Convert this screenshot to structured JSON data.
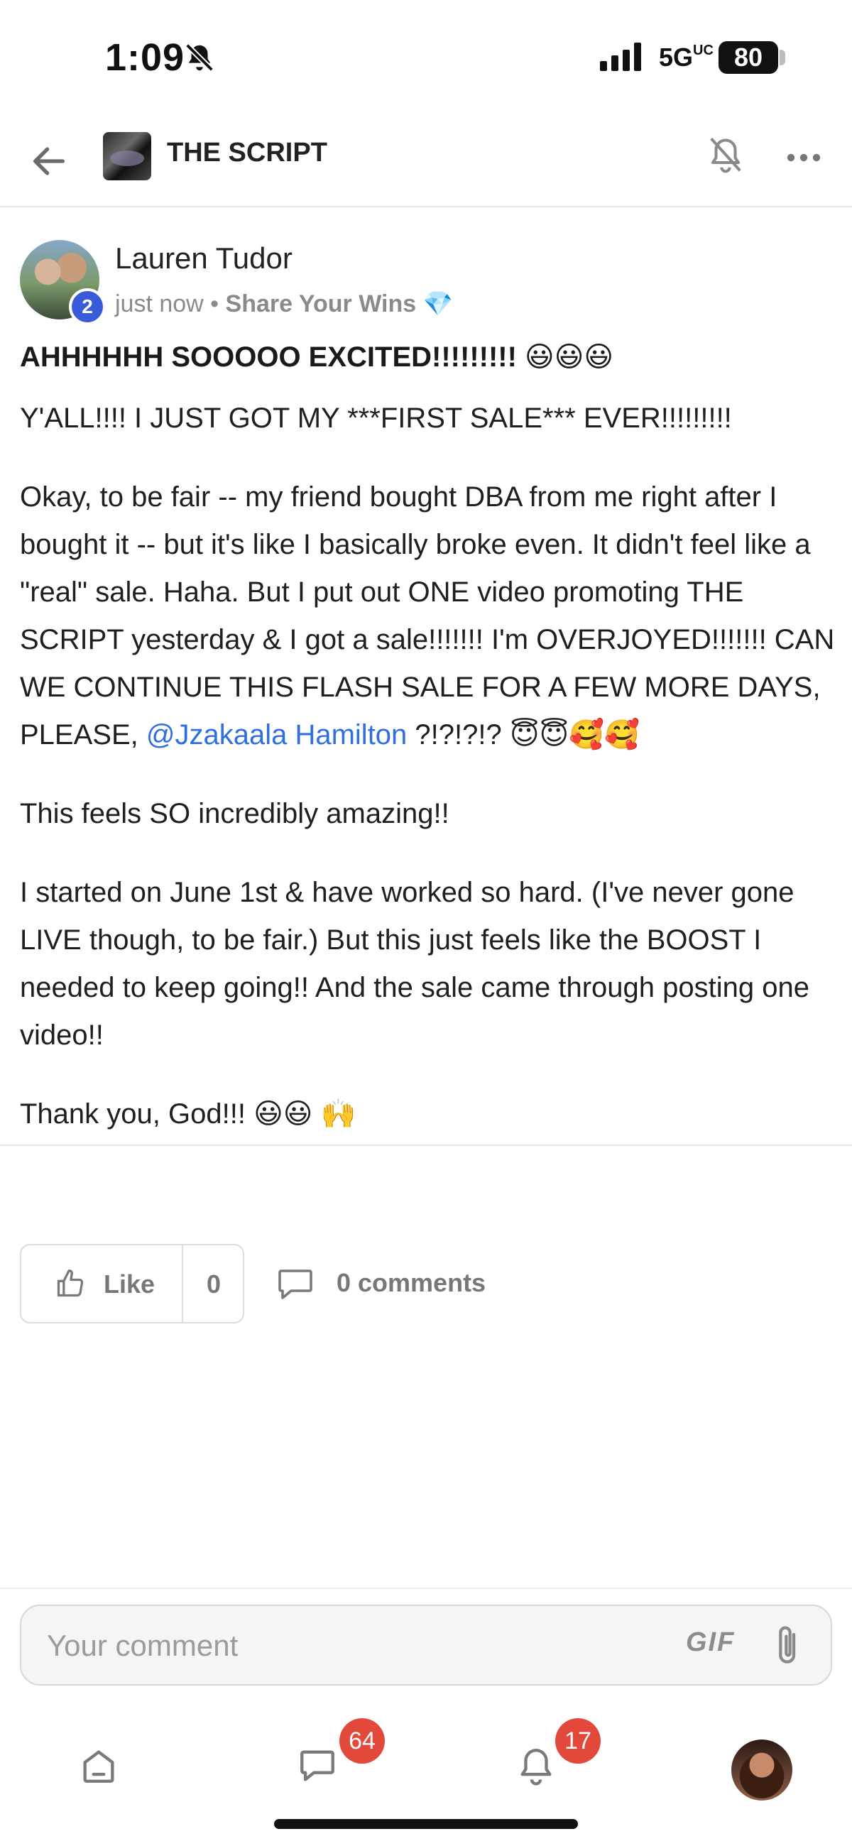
{
  "status_bar": {
    "time": "1:09",
    "network": "5G",
    "network_suffix": "UC",
    "battery": "80"
  },
  "header": {
    "title": "THE SCRIPT"
  },
  "post": {
    "author": "Lauren Tudor",
    "level": "2",
    "timestamp": "just now",
    "separator": " • ",
    "category": "Share Your Wins",
    "category_emoji": "💎",
    "title": "AHHHHHH SOOOOO EXCITED!!!!!!!!! 😃😃😃",
    "paragraphs": {
      "p1": "Y'ALL!!!! I JUST GOT MY ***FIRST SALE*** EVER!!!!!!!!!",
      "p2_start": "Okay, to be fair -- my friend bought DBA from me right after I bought it -- but it's like I basically broke even. It didn't feel like a \"real\" sale. Haha. But I put out ONE video promoting THE SCRIPT yesterday & I got a sale!!!!!!! I'm OVERJOYED!!!!!!! CAN WE CONTINUE THIS FLASH SALE FOR A FEW MORE DAYS, PLEASE, ",
      "p2_mention": "@Jzakaala Hamilton",
      "p2_end": " ?!?!?!? 😇😇🥰🥰",
      "p3": "This feels SO incredibly amazing!!",
      "p4": "I started on June 1st & have worked so hard. (I've never gone LIVE though, to be fair.) But this just feels like the BOOST I needed to keep going!! And the sale came through posting one video!!",
      "p5": "Thank you, God!!! 😃😃 🙌"
    },
    "like_label": "Like",
    "like_count": "0",
    "comments_label": "0 comments"
  },
  "comment_box": {
    "placeholder": "Your comment",
    "gif_label": "GIF"
  },
  "bottom_nav": {
    "chat_badge": "64",
    "notifications_badge": "17"
  }
}
